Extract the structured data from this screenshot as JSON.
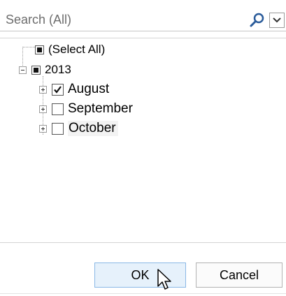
{
  "search": {
    "placeholder": "Search (All)",
    "icon": "magnifier-icon",
    "dropdown_icon": "chevron-down-icon"
  },
  "tree": {
    "select_all": {
      "label": "(Select All)",
      "state": "indeterminate"
    },
    "year": {
      "label": "2013",
      "state": "indeterminate",
      "expanded": true
    },
    "months": [
      {
        "label": "August",
        "checked": true,
        "expanded": false
      },
      {
        "label": "September",
        "checked": false,
        "expanded": false
      },
      {
        "label": "October",
        "checked": false,
        "expanded": false
      }
    ]
  },
  "buttons": {
    "ok": "OK",
    "cancel": "Cancel"
  },
  "colors": {
    "ok_bg": "#e6f1fb",
    "ok_border": "#8ab8e6"
  }
}
